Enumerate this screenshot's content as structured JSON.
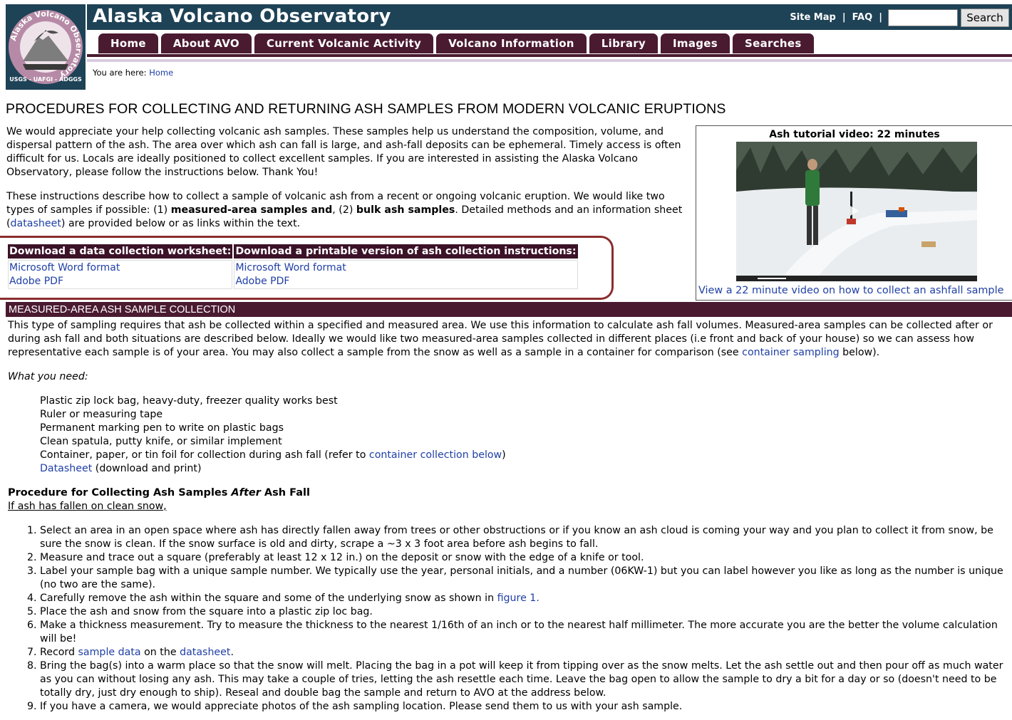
{
  "header": {
    "title": "Alaska Volcano Observatory",
    "logo_ring_text": "Alaska Volcano Observatory",
    "logo_bottom_text": "USGS - UAFGI - ADGGS",
    "site_map": "Site Map",
    "faq": "FAQ",
    "separator": "|",
    "search_value": "",
    "search_button": "Search"
  },
  "nav": {
    "tabs": [
      "Home",
      "About AVO",
      "Current Volcanic Activity",
      "Volcano Information",
      "Library",
      "Images",
      "Searches"
    ]
  },
  "breadcrumb": {
    "prefix": "You are here:",
    "home": "Home"
  },
  "page_title": "PROCEDURES FOR COLLECTING AND RETURNING ASH SAMPLES FROM MODERN VOLCANIC ERUPTIONS",
  "intro": {
    "p1": "We would appreciate your help collecting volcanic ash samples. These samples help us understand the composition, volume, and dispersal pattern of the ash. The area over which ash can fall is large, and ash-fall deposits can be ephemeral. Timely access is often difficult for us. Locals are ideally positioned to collect excellent samples. If you are interested in assisting the Alaska Volcano Observatory, please follow the instructions below. Thank You!",
    "p2_a": "These instructions describe how to collect a sample of volcanic ash from a recent or ongoing volcanic eruption. We would like two types of samples if possible: (1) ",
    "p2_bold1": "measured-area samples and",
    "p2_b": ", (2) ",
    "p2_bold2": "bulk ash samples",
    "p2_c": ". Detailed methods and an information sheet (",
    "p2_link": "datasheet",
    "p2_d": ") are provided below or as links within the text."
  },
  "video": {
    "title": "Ash tutorial video: 22 minutes",
    "link": "View a 22 minute video on how to collect an ashfall sample"
  },
  "downloads": {
    "col1_header": "Download a data collection worksheet:",
    "col2_header": "Download a printable version of ash collection instructions:",
    "word": "Microsoft Word format",
    "pdf": "Adobe PDF"
  },
  "section": {
    "heading": "MEASURED-AREA ASH SAMPLE COLLECTION",
    "p1_a": "This type of sampling requires that ash be collected within a specified and measured area. We use this information to calculate ash fall volumes. Measured-area samples can be collected after or during ash fall and both situations are described below. Ideally we would like two measured-area samples collected in different places (i.e front and back of your house) so we can assess how representative each sample is of your area. You may also collect a sample from the snow as well as a sample in a container for comparison (see ",
    "p1_link": "container sampling",
    "p1_b": " below).",
    "what_you_need": "What you need:",
    "needs": [
      "Plastic zip lock bag, heavy-duty, freezer quality works best",
      "Ruler or measuring tape",
      "Permanent marking pen to write on plastic bags",
      "Clean spatula, putty knife, or similar implement"
    ],
    "need5_a": "Container, paper, or tin foil for collection during ash fall (refer to ",
    "need5_link": "container collection below",
    "need5_b": ")",
    "need6_link": "Datasheet",
    "need6_b": " (download and print)",
    "procedure_a": "Procedure for Collecting Ash Samples ",
    "procedure_em": "After",
    "procedure_b": " Ash Fall",
    "clean_snow": "If ash has fallen on clean snow,",
    "steps": {
      "s1": "Select an area in an open space where ash has directly fallen away from trees or other obstructions or if you know an ash cloud is coming your way and you plan to collect it from snow, be sure the snow is clean. If the snow surface is old and dirty, scrape a ~3 x 3 foot area before ash begins to fall.",
      "s2": "Measure and trace out a square (preferably at least 12 x 12 in.) on the deposit or snow with the edge of a knife or tool.",
      "s3": "Label your sample bag with a unique sample number. We typically use the year, personal initials, and a number (06KW-1) but you can label however you like as long as the number is unique (no two are the same).",
      "s4_a": "Carefully remove the ash within the square and some of the underlying snow as shown in ",
      "s4_link": "figure 1.",
      "s5": "Place the ash and snow from the square into a plastic zip loc bag.",
      "s6": "Make a thickness measurement. Try to measure the thickness to the nearest 1/16th of an inch or to the nearest half millimeter. The more accurate you are the better the volume calculation will be!",
      "s7_a": "Record ",
      "s7_link1": "sample data",
      "s7_b": " on the ",
      "s7_link2": "datasheet",
      "s7_c": ".",
      "s8": "Bring the bag(s) into a warm place so that the snow will melt. Placing the bag in a pot will keep it from tipping over as the snow melts. Let the ash settle out and then pour off as much water as you can without losing any ash. This may take a couple of tries, letting the ash resettle each time. Leave the bag open to allow the sample to dry a bit for a day or so (doesn't need to be totally dry, just dry enough to ship). Reseal and double bag the sample and return to AVO at the address below.",
      "s9": "If you have a camera, we would appreciate photos of the ash sampling location. Please send them to us with your ash sample."
    }
  },
  "colors": {
    "header_bg": "#1e4256",
    "tab_bg": "#4a1a30",
    "link": "#1f3fa6",
    "highlight_outline": "#8b2d2d"
  }
}
